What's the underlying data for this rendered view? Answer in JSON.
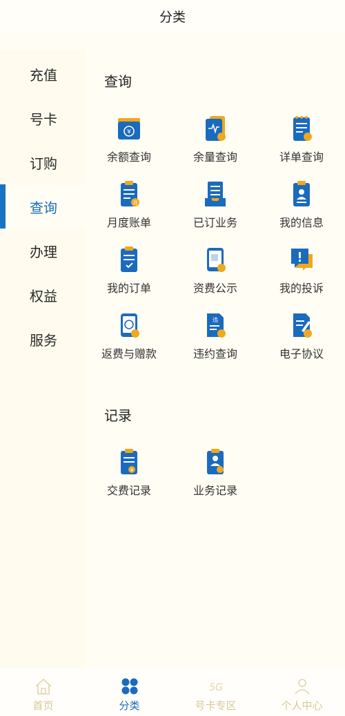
{
  "header": {
    "title": "分类"
  },
  "sidebar": {
    "items": [
      {
        "label": "充值"
      },
      {
        "label": "号卡"
      },
      {
        "label": "订购"
      },
      {
        "label": "查询"
      },
      {
        "label": "办理"
      },
      {
        "label": "权益"
      },
      {
        "label": "服务"
      }
    ]
  },
  "query_section": {
    "title": "查询",
    "items": [
      {
        "label": "余额查询",
        "icon": "wallet-icon"
      },
      {
        "label": "余量查询",
        "icon": "data-usage-icon"
      },
      {
        "label": "详单查询",
        "icon": "detail-list-icon"
      },
      {
        "label": "月度账单",
        "icon": "monthly-bill-icon"
      },
      {
        "label": "已订业务",
        "icon": "subscribed-service-icon"
      },
      {
        "label": "我的信息",
        "icon": "my-info-icon"
      },
      {
        "label": "我的订单",
        "icon": "my-order-icon"
      },
      {
        "label": "资费公示",
        "icon": "tariff-icon"
      },
      {
        "label": "我的投诉",
        "icon": "complaint-icon"
      },
      {
        "label": "返费与赠款",
        "icon": "refund-icon"
      },
      {
        "label": "违约查询",
        "icon": "breach-query-icon"
      },
      {
        "label": "电子协议",
        "icon": "e-agreement-icon"
      }
    ]
  },
  "record_section": {
    "title": "记录",
    "items": [
      {
        "label": "交费记录",
        "icon": "payment-record-icon"
      },
      {
        "label": "业务记录",
        "icon": "service-record-icon"
      }
    ]
  },
  "tabbar": {
    "items": [
      {
        "label": "首页",
        "icon": "home-icon"
      },
      {
        "label": "分类",
        "icon": "category-icon"
      },
      {
        "label": "号卡专区",
        "icon": "5g-icon"
      },
      {
        "label": "个人中心",
        "icon": "user-icon"
      }
    ]
  },
  "colors": {
    "primary": "#1a6bbd",
    "accent": "#f0a81e",
    "inactive": "#d8c89a"
  }
}
